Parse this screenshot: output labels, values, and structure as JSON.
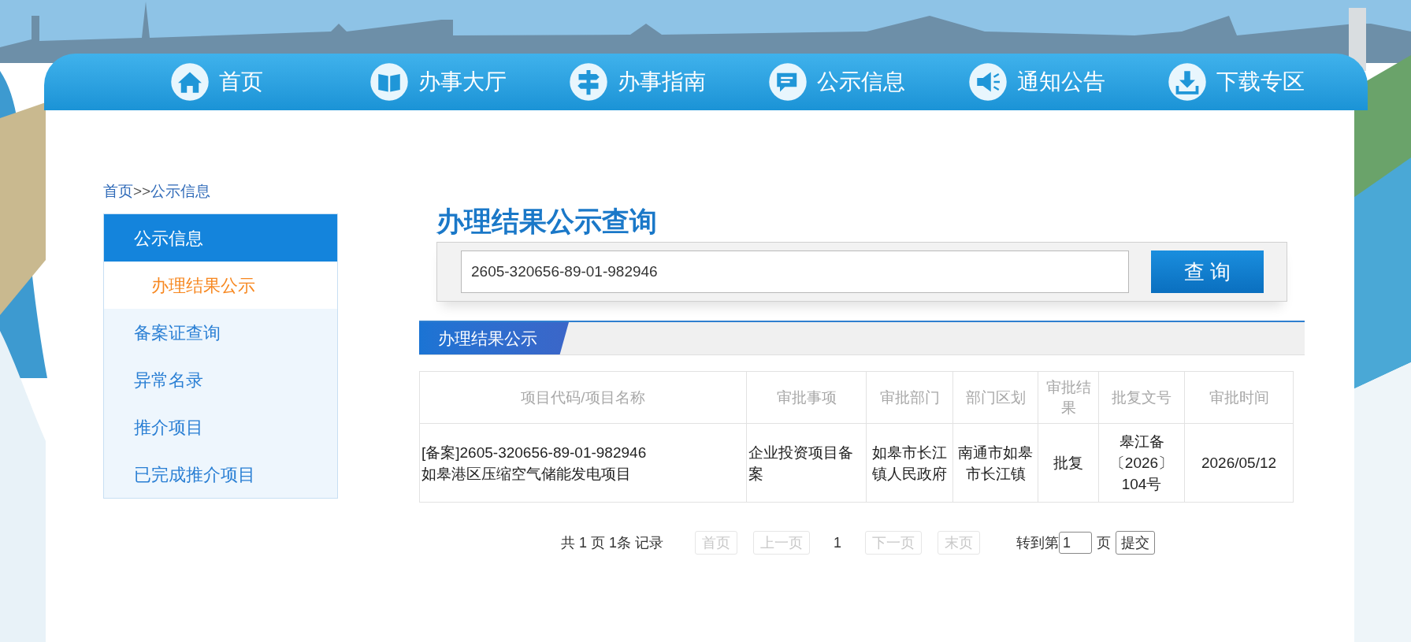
{
  "nav": [
    {
      "label": "首页"
    },
    {
      "label": "办事大厅"
    },
    {
      "label": "办事指南"
    },
    {
      "label": "公示信息"
    },
    {
      "label": "通知公告"
    },
    {
      "label": "下载专区"
    }
  ],
  "breadcrumb": [
    "首页",
    ">>",
    "公示信息"
  ],
  "sidebar": {
    "title": "公示信息",
    "items": [
      {
        "label": "办理结果公示",
        "kind": "sub",
        "selected": true
      },
      {
        "label": "备案证查询",
        "kind": "main",
        "selected": false
      },
      {
        "label": "异常名录",
        "kind": "main",
        "selected": false
      },
      {
        "label": "推介项目",
        "kind": "main",
        "selected": false
      },
      {
        "label": "已完成推介项目",
        "kind": "main",
        "selected": false
      }
    ]
  },
  "search": {
    "title": "办理结果公示查询",
    "value": "2605-320656-89-01-982946",
    "button": "查 询"
  },
  "section_tab": "办理结果公示",
  "table": {
    "columns": [
      "项目代码/项目名称",
      "审批事项",
      "审批部门",
      "部门区划",
      "审批结果",
      "批复文号",
      "审批时间"
    ],
    "rows": [
      [
        "[备案]2605-320656-89-01-982946\n如皋港区压缩空气储能发电项目",
        "企业投资项目备案",
        "如皋市长江镇人民政府",
        "南通市如皋市长江镇",
        "批复",
        "皋江备〔2026〕104号",
        "2026/05/12"
      ]
    ]
  },
  "pager": {
    "summary": [
      "共",
      "1",
      "页",
      "1条",
      "记录"
    ],
    "buttons": [
      {
        "label": "首页",
        "disabled": true
      },
      {
        "label": "上一页",
        "disabled": true
      },
      {
        "label": "1",
        "kind": "current"
      },
      {
        "label": "下一页",
        "disabled": true
      },
      {
        "label": "末页",
        "disabled": true
      }
    ],
    "goto_prefix": "转到第",
    "goto_value": "1",
    "goto_suffix": "页",
    "submit": "提交"
  }
}
